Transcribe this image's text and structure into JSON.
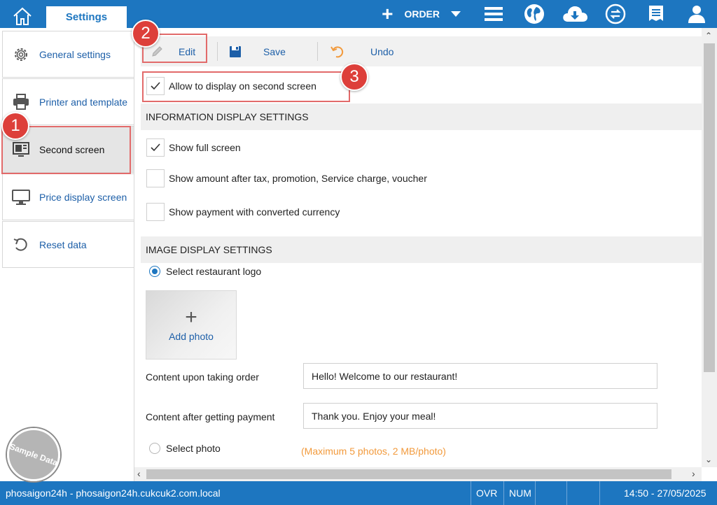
{
  "header": {
    "tab_settings": "Settings",
    "order_label": "ORDER",
    "icons": [
      "home-icon",
      "plus-icon",
      "hamburger-menu-icon",
      "globe-icon",
      "cloud-download-icon",
      "sync-icon",
      "receipt-icon",
      "user-icon"
    ],
    "accent_color": "#1d76c0"
  },
  "sidebar": {
    "items": [
      {
        "label": "General settings",
        "icon": "gear-icon"
      },
      {
        "label": "Printer and template",
        "icon": "printer-icon"
      },
      {
        "label": "Second screen",
        "icon": "monitor-layout-icon"
      },
      {
        "label": "Price display screen",
        "icon": "monitor-icon"
      },
      {
        "label": "Reset data",
        "icon": "undo-icon"
      }
    ],
    "active": "Second screen"
  },
  "toolbar": {
    "edit_label": "Edit",
    "save_label": "Save",
    "undo_label": "Undo"
  },
  "content": {
    "allow_label": "Allow to display on second screen",
    "allow_checked": true,
    "info_section": "INFORMATION DISPLAY SETTINGS",
    "show_full_screen_label": "Show full screen",
    "show_full_screen_checked": true,
    "show_amount_label": "Show amount after tax, promotion, Service charge, voucher",
    "show_amount_checked": false,
    "show_payment_label": "Show payment with converted currency",
    "show_payment_checked": false,
    "image_section": "IMAGE DISPLAY SETTINGS",
    "select_logo_label": "Select restaurant logo",
    "select_logo_selected": true,
    "add_photo_label": "Add photo",
    "content_order_label": "Content upon taking order",
    "content_order_value": "Hello! Welcome to our restaurant!",
    "content_payment_label": "Content after getting payment",
    "content_payment_value": "Thank you. Enjoy your meal!",
    "select_photo_label": "Select photo",
    "select_photo_selected": false,
    "photo_hint": "(Maximum 5 photos, 2 MB/photo)"
  },
  "statusbar": {
    "connection": "phosaigon24h - phosaigon24h.cukcuk2.com.local",
    "ovr": "OVR",
    "num": "NUM",
    "datetime": "14:50 - 27/05/2025"
  },
  "annotations": {
    "badge_1": "1",
    "badge_2": "2",
    "badge_3": "3",
    "highlight_color": "#e26a6a"
  },
  "watermark": "Sample Data"
}
